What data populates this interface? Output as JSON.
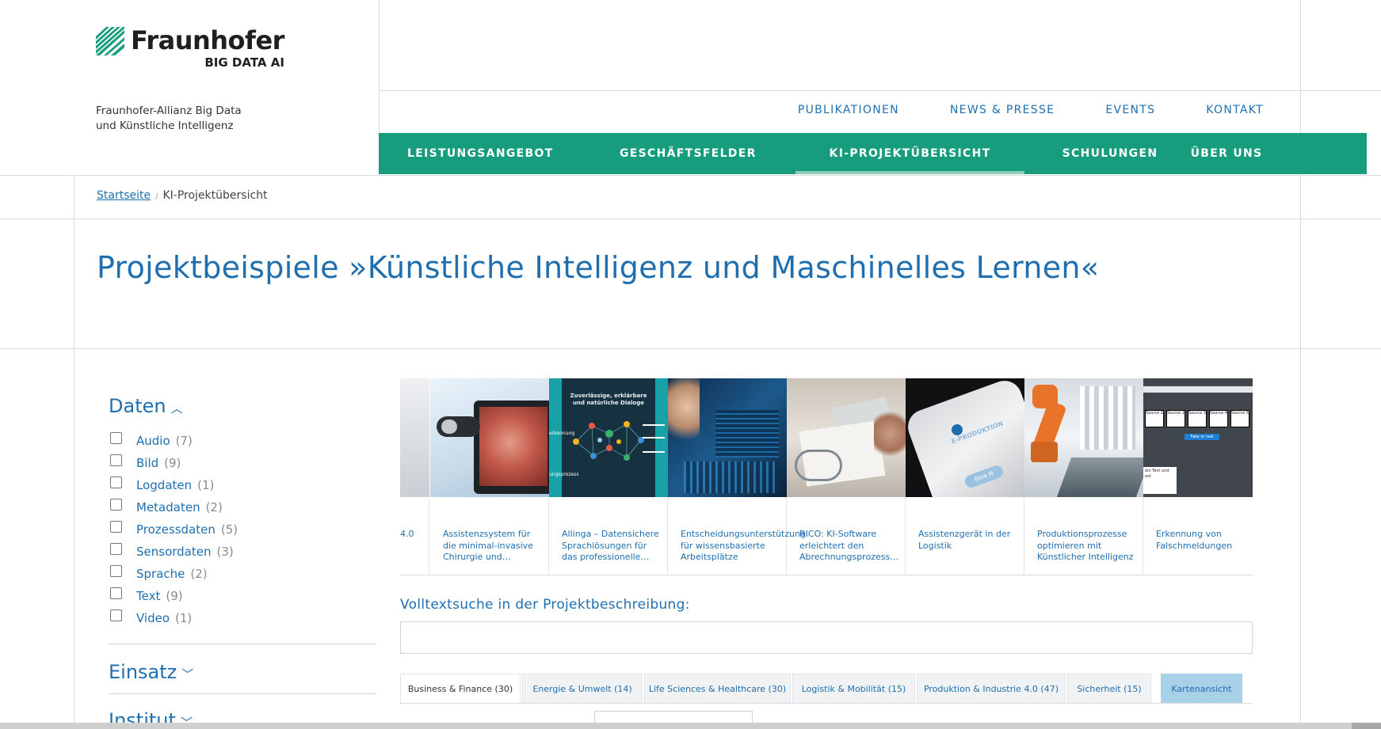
{
  "logo": {
    "name": "Fraunhofer",
    "sub": "BIG DATA AI"
  },
  "alliance": {
    "line1": "Fraunhofer-Allianz Big Data",
    "line2": "und Künstliche Intelligenz"
  },
  "top_nav": [
    "PUBLIKATIONEN",
    "NEWS & PRESSE",
    "EVENTS",
    "KONTAKT"
  ],
  "main_nav": [
    {
      "label": "LEISTUNGSANGEBOT",
      "active": false
    },
    {
      "label": "GESCHÄFTSFELDER",
      "active": false
    },
    {
      "label": "KI-PROJEKTÜBERSICHT",
      "active": true
    },
    {
      "label": "SCHULUNGEN",
      "active": false
    },
    {
      "label": "ÜBER UNS",
      "active": false
    }
  ],
  "breadcrumb": {
    "home": "Startseite",
    "separator": "/",
    "current": "KI-Projektübersicht"
  },
  "page_title": "Projektbeispiele »Künstliche Intelligenz und Maschinelles Lernen«",
  "filters": {
    "daten": {
      "label": "Daten",
      "items": [
        {
          "label": "Audio",
          "count": "(7)"
        },
        {
          "label": "Bild",
          "count": "(9)"
        },
        {
          "label": "Logdaten",
          "count": "(1)"
        },
        {
          "label": "Metadaten",
          "count": "(2)"
        },
        {
          "label": "Prozessdaten",
          "count": "(5)"
        },
        {
          "label": "Sensordaten",
          "count": "(3)"
        },
        {
          "label": "Sprache",
          "count": "(2)"
        },
        {
          "label": "Text",
          "count": "(9)"
        },
        {
          "label": "Video",
          "count": "(1)"
        }
      ]
    },
    "einsatz": {
      "label": "Einsatz"
    },
    "institut": {
      "label": "Institut"
    }
  },
  "carousel": [
    {
      "title": "4.0"
    },
    {
      "title": "Assistenzsystem für die minimal-invasive Chirurgie und…"
    },
    {
      "title": "Allinga – Datensichere Sprachlösungen für das professionelle…",
      "img_text_1": "Zuverlässige, erklärbare",
      "img_text_2": "und natürliche Dialoge",
      "img_text_3": "erkennung",
      "img_text_4": "ungsprozess"
    },
    {
      "title": "Entscheidungsunterstützung für wissensbasierte Arbeitsplätze"
    },
    {
      "title": "RICO: KI-Software erleichtert den Abrechnungsprozess…"
    },
    {
      "title": "Assistenzgerät in der Logistik",
      "img_text": "E-PRODUKTION",
      "img_text_2": "Bitte M"
    },
    {
      "title": "Produktionsprozesse optimieren mit Künstlicher Intelligenz"
    },
    {
      "title": "Erkennung von Falschmeldungen",
      "img_sources": [
        "Source 1",
        "Source 2",
        "Source 3",
        "Source 4",
        "Source 5"
      ],
      "img_text": "Fake or real",
      "img_note": "ein Text und ext"
    }
  ],
  "search": {
    "label": "Volltextsuche in der Projektbeschreibung:",
    "value": "",
    "placeholder": ""
  },
  "tabs": [
    {
      "label": "Business & Finance (30)",
      "active": true
    },
    {
      "label": "Energie & Umwelt (14)",
      "active": false
    },
    {
      "label": "Life Sciences & Healthcare (30)",
      "active": false
    },
    {
      "label": "Logistik & Mobilität (15)",
      "active": false
    },
    {
      "label": "Produktion & Industrie 4.0 (47)",
      "active": false
    },
    {
      "label": "Sicherheit (15)",
      "active": false
    },
    {
      "label": "Kartenansicht",
      "active": false
    }
  ],
  "colors": {
    "brand_green": "#179c7d",
    "link_blue": "#1f6fb0",
    "tab_map": "#a8d1e8"
  }
}
